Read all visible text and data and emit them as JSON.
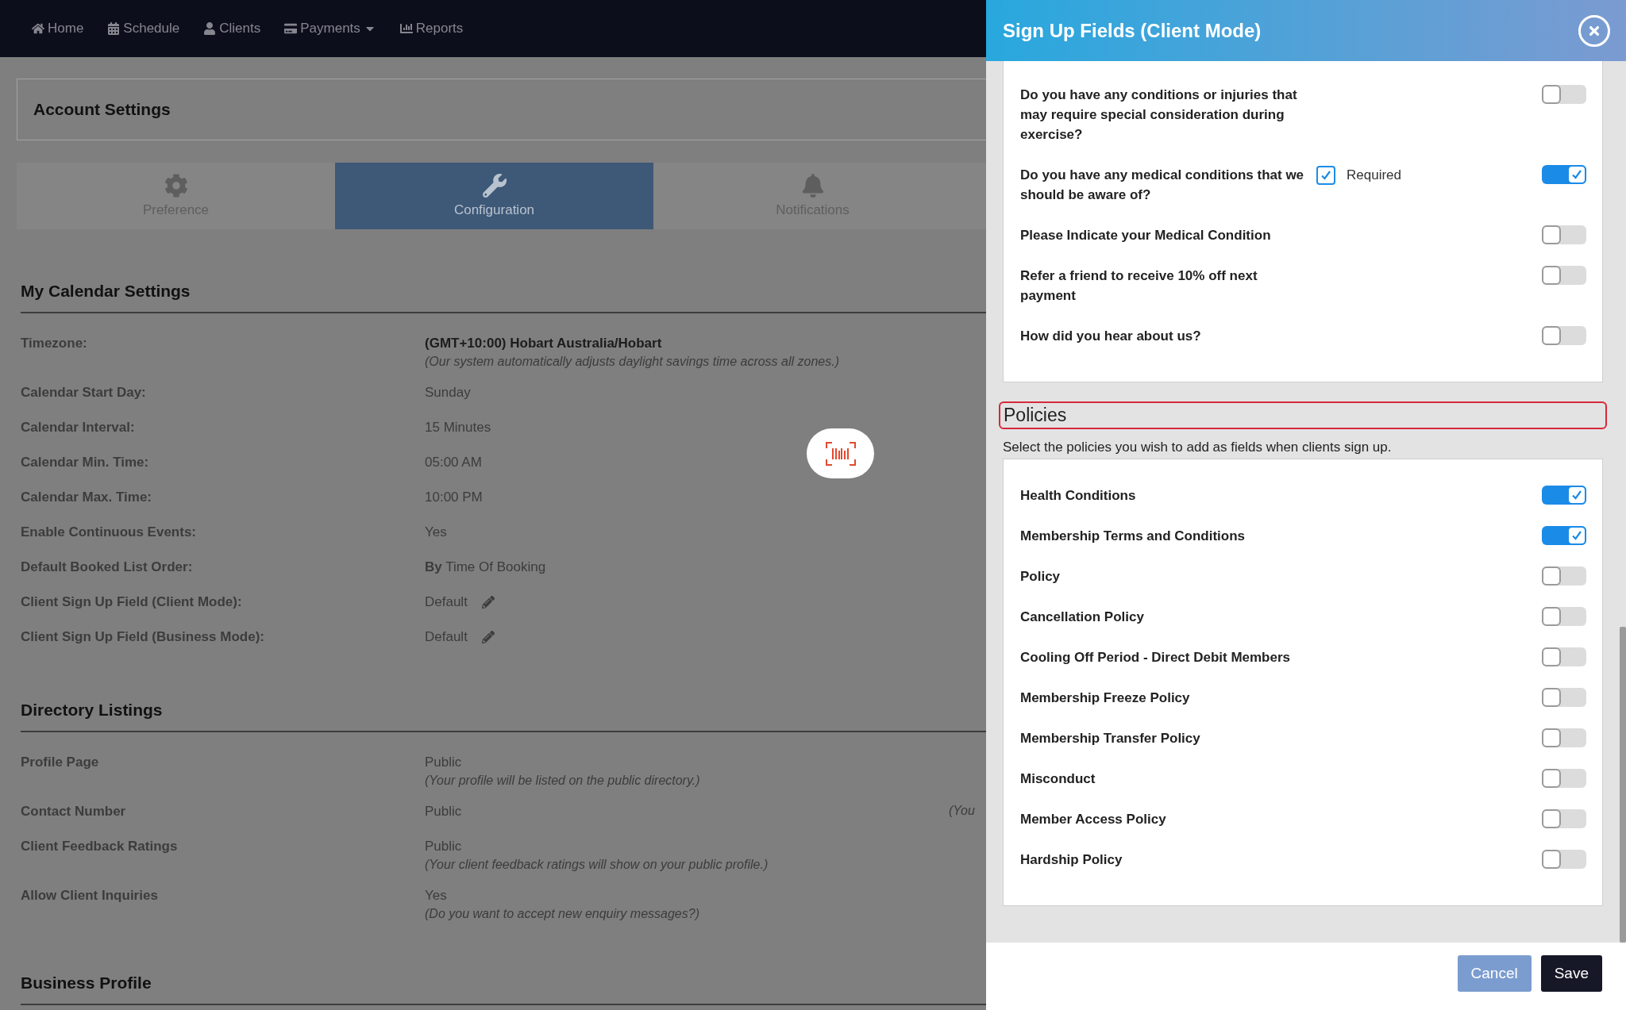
{
  "nav": [
    {
      "label": "Home"
    },
    {
      "label": "Schedule"
    },
    {
      "label": "Clients"
    },
    {
      "label": "Payments",
      "has_menu": true
    },
    {
      "label": "Reports"
    }
  ],
  "account_settings": {
    "title": "Account Settings"
  },
  "tabs": [
    {
      "label": "Preference",
      "selected": false
    },
    {
      "label": "Configuration",
      "selected": true
    },
    {
      "label": "Notifications",
      "selected": false
    }
  ],
  "sections": [
    {
      "title": "My Calendar Settings",
      "rows": [
        {
          "label": "Timezone:",
          "value": "(GMT+10:00) Hobart Australia/Hobart",
          "value_bold": true,
          "note": "(Our system automatically adjusts daylight savings time across all zones.)"
        },
        {
          "label": "Calendar Start Day:",
          "value": "Sunday"
        },
        {
          "label": "Calendar Interval:",
          "value": "15 Minutes"
        },
        {
          "label": "Calendar Min. Time:",
          "value": "05:00 AM"
        },
        {
          "label": "Calendar Max. Time:",
          "value": "10:00 PM"
        },
        {
          "label": "Enable Continuous Events:",
          "value": "Yes"
        },
        {
          "label": "Default Booked List Order:",
          "value": "**By** Time Of Booking"
        },
        {
          "label": "Client Sign Up Field (Client Mode):",
          "value": "Default",
          "editable": true
        },
        {
          "label": "Client Sign Up Field (Business Mode):",
          "value": "Default",
          "editable": true
        }
      ]
    },
    {
      "title": "Directory Listings",
      "rows": [
        {
          "label": "Profile Page",
          "value": "Public",
          "note": "(Your profile will be listed on the public directory.)"
        },
        {
          "label": "Contact Number",
          "value": "Public",
          "side_note": "(You"
        },
        {
          "label": "Client Feedback Ratings",
          "value": "Public",
          "note": "(Your client feedback ratings will show on your public profile.)"
        },
        {
          "label": "Allow Client Inquiries",
          "value": "Yes",
          "note": "(Do you want to accept new enquiry messages?)"
        }
      ]
    },
    {
      "title": "Business Profile"
    }
  ],
  "panel": {
    "title": "Sign Up Fields (Client Mode)",
    "fields": [
      {
        "label": "Do you have any conditions or injuries that may require special consideration during exercise?",
        "on": false
      },
      {
        "label": "Do you have any medical conditions that we should be aware of?",
        "on": true,
        "required": {
          "label": "Required",
          "checked": true
        }
      },
      {
        "label": "Please Indicate your Medical Condition",
        "on": false
      },
      {
        "label": "Refer a friend to receive 10% off next payment",
        "on": false
      },
      {
        "label": "How did you hear about us?",
        "on": false
      }
    ],
    "policies": {
      "title": "Policies",
      "description": "Select the policies you wish to add as fields when clients sign up.",
      "items": [
        {
          "label": "Health Conditions",
          "on": true
        },
        {
          "label": "Membership Terms and Conditions",
          "on": true
        },
        {
          "label": "Policy",
          "on": false
        },
        {
          "label": "Cancellation Policy",
          "on": false
        },
        {
          "label": "Cooling Off Period - Direct Debit Members",
          "on": false
        },
        {
          "label": "Membership Freeze Policy",
          "on": false
        },
        {
          "label": "Membership Transfer Policy",
          "on": false
        },
        {
          "label": "Misconduct",
          "on": false
        },
        {
          "label": "Member Access Policy",
          "on": false
        },
        {
          "label": "Hardship Policy",
          "on": false
        }
      ]
    },
    "buttons": [
      {
        "label": "Cancel",
        "kind": "secondary"
      },
      {
        "label": "Save",
        "kind": "primary"
      }
    ]
  }
}
